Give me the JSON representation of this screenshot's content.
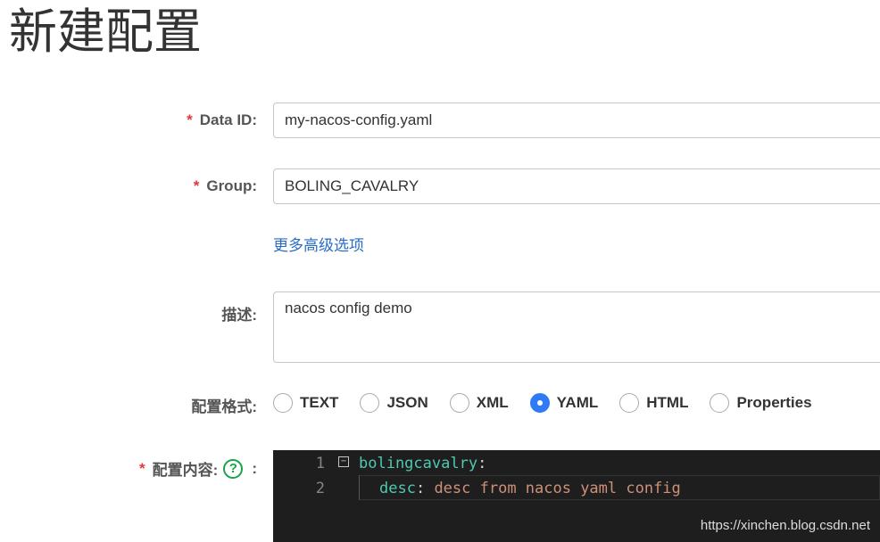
{
  "page": {
    "title": "新建配置"
  },
  "form": {
    "data_id": {
      "required": "*",
      "label": "Data ID:",
      "value": "my-nacos-config.yaml"
    },
    "group": {
      "required": "*",
      "label": "Group:",
      "value": "BOLING_CAVALRY"
    },
    "more_options_link": "更多高级选项",
    "description": {
      "label": "描述:",
      "value": "nacos config demo"
    },
    "format": {
      "label": "配置格式:",
      "options": [
        "TEXT",
        "JSON",
        "XML",
        "YAML",
        "HTML",
        "Properties"
      ],
      "selected": "YAML"
    },
    "content": {
      "required": "*",
      "label": "配置内容:",
      "help": "?",
      "colon": ":",
      "lines": [
        {
          "num": "1",
          "key": "bolingcavalry",
          "colon": ":",
          "value": ""
        },
        {
          "num": "2",
          "key": "desc",
          "colon": ":",
          "value": " desc from nacos yaml config"
        }
      ],
      "watermark": "https://xinchen.blog.csdn.net"
    }
  },
  "colors": {
    "accent": "#2f7bf5",
    "link": "#2a6cc4",
    "required": "#e4393c",
    "help": "#1aa34a"
  }
}
